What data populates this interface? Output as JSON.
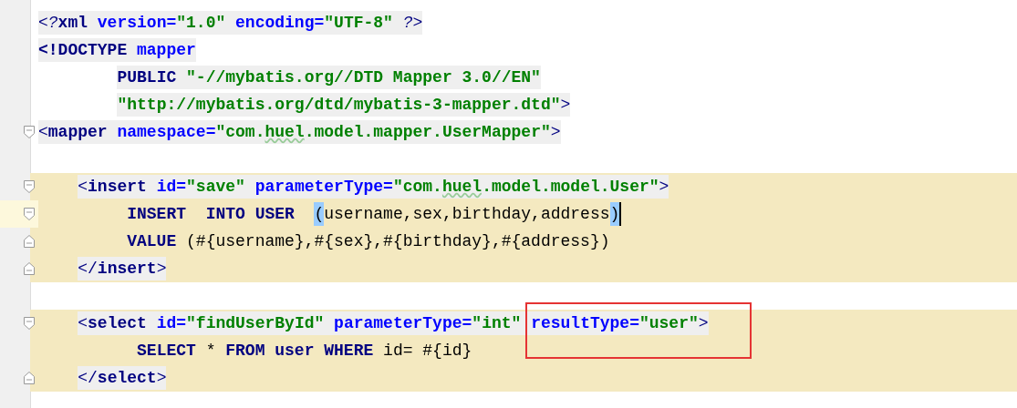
{
  "editor": {
    "lines": [
      {
        "tokens": [
          {
            "kind": "pi",
            "text": "<?"
          },
          {
            "kind": "tag",
            "text": "xml"
          },
          {
            "kind": "attr",
            "text": " version="
          },
          {
            "kind": "value",
            "text": "\"1.0\""
          },
          {
            "kind": "attr",
            "text": " encoding="
          },
          {
            "kind": "value",
            "text": "\"UTF-8\""
          },
          {
            "kind": "pi",
            "text": " ?>"
          }
        ],
        "tag_bg": true
      },
      {
        "tokens": [
          {
            "kind": "tag",
            "text": "<!DOCTYPE"
          },
          {
            "kind": "attr",
            "text": " mapper"
          }
        ],
        "tag_bg": true
      },
      {
        "tokens": [
          {
            "kind": "tag",
            "text": "        PUBLIC"
          },
          {
            "kind": "value",
            "text": " \"-//mybatis.org//DTD Mapper 3.0//EN\""
          }
        ],
        "tag_bg": true
      },
      {
        "tokens": [
          {
            "kind": "value",
            "text": "        \"http://mybatis.org/dtd/mybatis-3-mapper.dtd\""
          },
          {
            "kind": "punct",
            "text": ">"
          }
        ],
        "tag_bg": true
      },
      {
        "tokens": [
          {
            "kind": "punct",
            "text": "<"
          },
          {
            "kind": "tag",
            "text": "mapper"
          },
          {
            "kind": "attr",
            "text": " namespace="
          },
          {
            "kind": "value",
            "text": "\"com."
          },
          {
            "kind": "value",
            "text": "huel",
            "typo": true
          },
          {
            "kind": "value",
            "text": ".model.mapper.UserMapper\""
          },
          {
            "kind": "punct",
            "text": ">"
          }
        ],
        "tag_bg": true,
        "fold_start": true
      },
      {
        "blank_before": true,
        "tokens": [
          {
            "kind": "punct",
            "text": "    <"
          },
          {
            "kind": "tag",
            "text": "insert"
          },
          {
            "kind": "attr",
            "text": " id="
          },
          {
            "kind": "value",
            "text": "\"save\""
          },
          {
            "kind": "attr",
            "text": " parameterType="
          },
          {
            "kind": "value",
            "text": "\"com."
          },
          {
            "kind": "value",
            "text": "huel",
            "typo": true
          },
          {
            "kind": "value",
            "text": ".model.model.User\""
          },
          {
            "kind": "punct",
            "text": ">"
          }
        ],
        "tag_bg": true,
        "band": true,
        "fold_start": true
      },
      {
        "tokens": [
          {
            "kind": "keyword",
            "text": "         INSERT  INTO USER  "
          },
          {
            "kind": "text",
            "text": "(",
            "match": true
          },
          {
            "kind": "text",
            "text": "username,sex,birthday,address"
          },
          {
            "kind": "text",
            "text": ")",
            "match": true,
            "caret": true
          }
        ],
        "band": true,
        "current": true,
        "fold_start": true
      },
      {
        "tokens": [
          {
            "kind": "keyword",
            "text": "         VALUE"
          },
          {
            "kind": "text",
            "text": " (#{username},#{sex},#{birthday},#{address})"
          }
        ],
        "band": true,
        "fold_end": true
      },
      {
        "tokens": [
          {
            "kind": "punct",
            "text": "    </"
          },
          {
            "kind": "tag",
            "text": "insert"
          },
          {
            "kind": "punct",
            "text": ">"
          }
        ],
        "tag_bg": true,
        "band": true,
        "fold_end": true
      },
      {
        "blank_before": true,
        "tokens": [
          {
            "kind": "punct",
            "text": "    <"
          },
          {
            "kind": "tag",
            "text": "select"
          },
          {
            "kind": "attr",
            "text": " id="
          },
          {
            "kind": "value",
            "text": "\"findUserById\""
          },
          {
            "kind": "attr",
            "text": " parameterType="
          },
          {
            "kind": "value",
            "text": "\"int\" "
          },
          {
            "kind": "attr",
            "text": "resultType=",
            "boxed": true
          },
          {
            "kind": "value",
            "text": "\"user\""
          },
          {
            "kind": "punct",
            "text": ">"
          }
        ],
        "tag_bg": true,
        "band": true,
        "fold_start": true
      },
      {
        "tokens": [
          {
            "kind": "keyword",
            "text": "          SELECT"
          },
          {
            "kind": "text",
            "text": " * "
          },
          {
            "kind": "keyword",
            "text": "FROM user WHERE"
          },
          {
            "kind": "text",
            "text": " id= #{id}"
          }
        ],
        "band": true
      },
      {
        "tokens": [
          {
            "kind": "punct",
            "text": "    </"
          },
          {
            "kind": "tag",
            "text": "select"
          },
          {
            "kind": "punct",
            "text": ">"
          }
        ],
        "tag_bg": true,
        "band": true,
        "fold_end": true
      }
    ]
  }
}
